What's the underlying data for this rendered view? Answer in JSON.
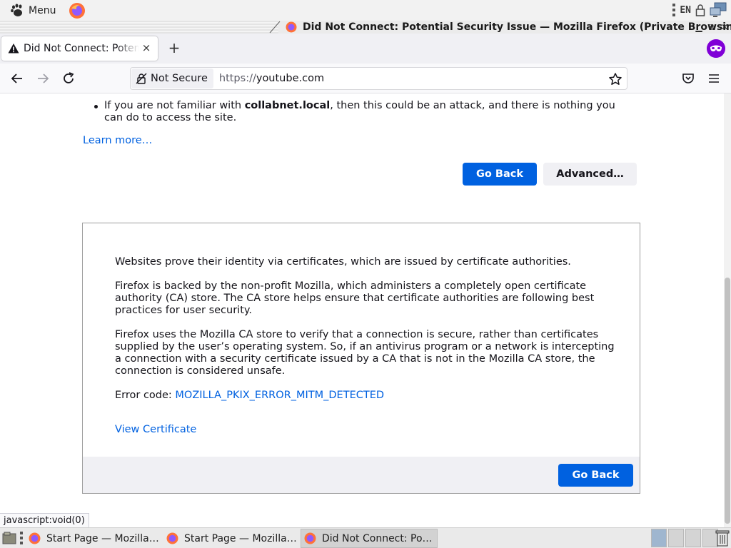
{
  "top_panel": {
    "menu_label": "Menu",
    "keyboard_layout": "EN",
    "icons": [
      "gnome-foot-icon",
      "firefox-launcher-icon",
      "keyboard-layout-indicator",
      "lock-icon",
      "network-icon"
    ]
  },
  "window": {
    "title": "Did Not Connect: Potential Security Issue — Mozilla Firefox (Private Browsing)",
    "controls": [
      "minimize",
      "maximize",
      "close"
    ]
  },
  "tabs": {
    "active_tab_label": "Did Not Connect: Potential Security Issue",
    "new_tab_symbol": "+",
    "close_symbol": "×"
  },
  "toolbar": {
    "not_secure_label": "Not Secure",
    "url_scheme": "https://",
    "url_host": "youtube.com"
  },
  "page": {
    "bullet_prefix": "If you are not familiar with ",
    "bullet_host": "collabnet.local",
    "bullet_suffix": ", then this could be an attack, and there is nothing you can do to access the site.",
    "learn_more": "Learn more…",
    "go_back_label": "Go Back",
    "advanced_label": "Advanced…",
    "advanced_panel": {
      "para1": "Websites prove their identity via certificates, which are issued by certificate authorities.",
      "para2": "Firefox is backed by the non-profit Mozilla, which administers a completely open certificate authority (CA) store. The CA store helps ensure that certificate authorities are following best practices for user security.",
      "para3": "Firefox uses the Mozilla CA store to verify that a connection is secure, rather than certificates supplied by the user’s operating system. So, if an antivirus program or a network is intercepting a connection with a security certificate issued by a CA that is not in the Mozilla CA store, the connection is considered unsafe.",
      "error_code_label": "Error code: ",
      "error_code": "MOZILLA_PKIX_ERROR_MITM_DETECTED",
      "view_certificate": "View Certificate",
      "go_back_label": "Go Back"
    }
  },
  "status_bar": {
    "link_preview": "javascript:void(0)"
  },
  "taskbar": {
    "items": [
      {
        "label": "Start Page — Mozilla Firefox",
        "active": false
      },
      {
        "label": "Start Page — Mozilla Firefox",
        "active": false
      },
      {
        "label": "Did Not Connect: Potential Security Issue",
        "active": true
      }
    ]
  },
  "colors": {
    "accent_blue": "#0061e0",
    "private_purple": "#8000d7",
    "page_bg": "#ffffff"
  }
}
